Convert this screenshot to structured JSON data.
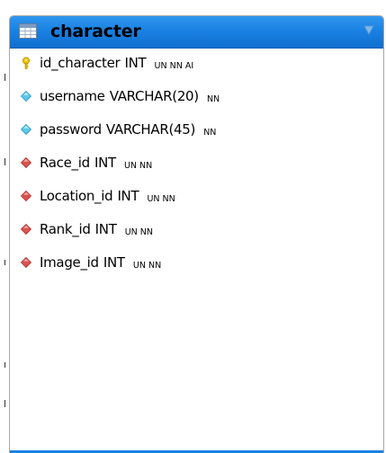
{
  "table": {
    "name": "character",
    "header_color": "#1a82e3",
    "columns": [
      {
        "name": "id_character",
        "type": "INT",
        "flags": "UN NN AI",
        "icon": "primary-key-icon"
      },
      {
        "name": "username",
        "type": "VARCHAR(20)",
        "flags": "NN",
        "icon": "column-icon"
      },
      {
        "name": "password",
        "type": "VARCHAR(45)",
        "flags": "NN",
        "icon": "column-icon"
      },
      {
        "name": "Race_id",
        "type": "INT",
        "flags": "UN NN",
        "icon": "foreign-key-icon"
      },
      {
        "name": "Location_id",
        "type": "INT",
        "flags": "UN NN",
        "icon": "foreign-key-icon"
      },
      {
        "name": "Rank_id",
        "type": "INT",
        "flags": "UN NN",
        "icon": "foreign-key-icon"
      },
      {
        "name": "Image_id",
        "type": "INT",
        "flags": "UN NN",
        "icon": "foreign-key-icon"
      }
    ]
  },
  "colors": {
    "primary_key": "#f2c200",
    "column": "#5cc8e8",
    "foreign_key": "#d9534f"
  }
}
